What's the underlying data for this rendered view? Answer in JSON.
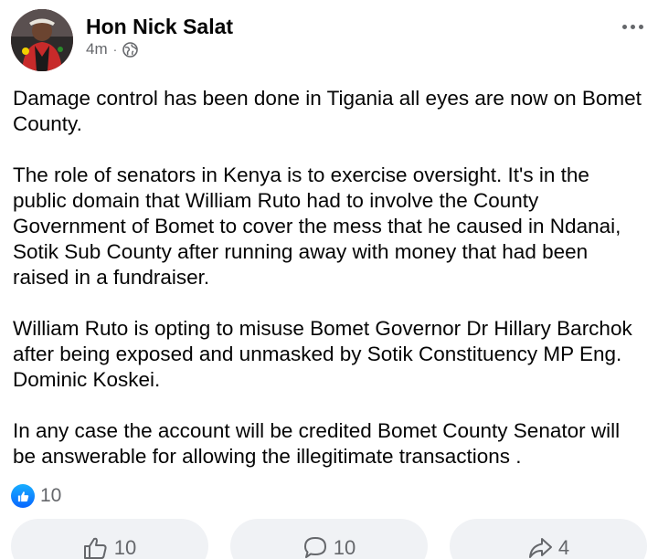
{
  "post": {
    "author": "Hon Nick Salat",
    "time": "4m",
    "separator": "·",
    "privacy_icon": "globe-icon",
    "more_icon": "more-options-icon",
    "paragraphs": [
      "Damage control has been done in Tigania all eyes are now on Bomet County.",
      "The role of senators in Kenya is to exercise oversight. It's in the public domain that William Ruto had to involve the County Government of Bomet to cover the mess that he caused in Ndanai, Sotik Sub County  after running away with money that had been raised in a fundraiser.",
      "William Ruto is opting to misuse Bomet Governor Dr Hillary Barchok after being exposed and unmasked by Sotik Constituency MP Eng. Dominic Koskei.",
      "In any case the account will be credited Bomet County Senator will be answerable for allowing the illegitimate transactions ."
    ],
    "reaction_count": "10"
  },
  "actions": {
    "like_count": "10",
    "comment_count": "10",
    "share_count": "4"
  },
  "colors": {
    "accent": "#0866ff",
    "muted": "#65676b",
    "button_bg": "#f0f2f5"
  }
}
